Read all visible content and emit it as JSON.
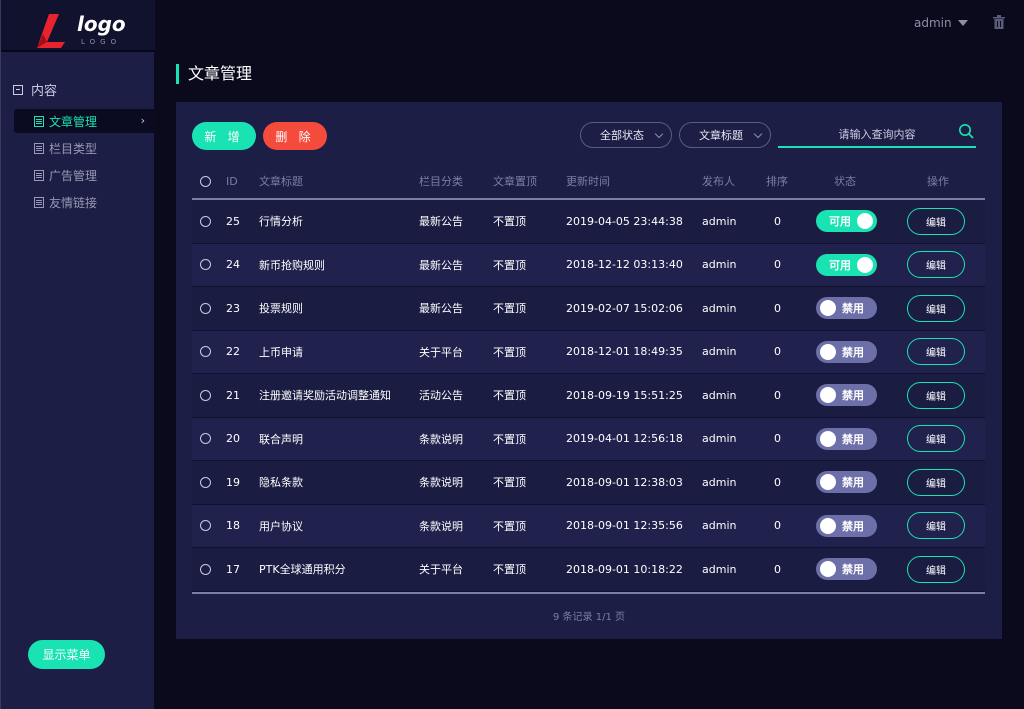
{
  "brand": {
    "logo_text": "logo",
    "logo_sub": "LOGO",
    "colors": {
      "accent": "#19e3b2",
      "danger": "#f44b3d",
      "logo_red": "#e8232d"
    }
  },
  "header": {
    "user": "admin"
  },
  "sidebar": {
    "group_label": "内容",
    "items": [
      {
        "label": "文章管理",
        "active": true
      },
      {
        "label": "栏目类型",
        "active": false
      },
      {
        "label": "广告管理",
        "active": false
      },
      {
        "label": "友情链接",
        "active": false
      }
    ],
    "show_menu_label": "显示菜单"
  },
  "page": {
    "title": "文章管理"
  },
  "toolbar": {
    "add_label": "新 增",
    "delete_label": "删 除",
    "status_select": "全部状态",
    "field_select": "文章标题",
    "search_placeholder": "请输入查询内容"
  },
  "table": {
    "headers": [
      "ID",
      "文章标题",
      "栏目分类",
      "文章置顶",
      "更新时间",
      "发布人",
      "排序",
      "状态",
      "操作"
    ],
    "rows": [
      {
        "id": "25",
        "title": "行情分析",
        "category": "最新公告",
        "pinned": "不置顶",
        "updated": "2019-04-05 23:44:38",
        "author": "admin",
        "sort": "0",
        "status": "可用",
        "enabled": true,
        "action": "编辑"
      },
      {
        "id": "24",
        "title": "新币抢购规则",
        "category": "最新公告",
        "pinned": "不置顶",
        "updated": "2018-12-12 03:13:40",
        "author": "admin",
        "sort": "0",
        "status": "可用",
        "enabled": true,
        "action": "编辑"
      },
      {
        "id": "23",
        "title": "投票规则",
        "category": "最新公告",
        "pinned": "不置顶",
        "updated": "2019-02-07 15:02:06",
        "author": "admin",
        "sort": "0",
        "status": "禁用",
        "enabled": false,
        "action": "编辑"
      },
      {
        "id": "22",
        "title": "上币申请",
        "category": "关于平台",
        "pinned": "不置顶",
        "updated": "2018-12-01 18:49:35",
        "author": "admin",
        "sort": "0",
        "status": "禁用",
        "enabled": false,
        "action": "编辑"
      },
      {
        "id": "21",
        "title": "注册邀请奖励活动调整通知",
        "category": "活动公告",
        "pinned": "不置顶",
        "updated": "2018-09-19 15:51:25",
        "author": "admin",
        "sort": "0",
        "status": "禁用",
        "enabled": false,
        "action": "编辑"
      },
      {
        "id": "20",
        "title": "联合声明",
        "category": "条款说明",
        "pinned": "不置顶",
        "updated": "2019-04-01 12:56:18",
        "author": "admin",
        "sort": "0",
        "status": "禁用",
        "enabled": false,
        "action": "编辑"
      },
      {
        "id": "19",
        "title": "隐私条款",
        "category": "条款说明",
        "pinned": "不置顶",
        "updated": "2018-09-01 12:38:03",
        "author": "admin",
        "sort": "0",
        "status": "禁用",
        "enabled": false,
        "action": "编辑"
      },
      {
        "id": "18",
        "title": "用户协议",
        "category": "条款说明",
        "pinned": "不置顶",
        "updated": "2018-09-01 12:35:56",
        "author": "admin",
        "sort": "0",
        "status": "禁用",
        "enabled": false,
        "action": "编辑"
      },
      {
        "id": "17",
        "title": "PTK全球通用积分",
        "category": "关于平台",
        "pinned": "不置顶",
        "updated": "2018-09-01 10:18:22",
        "author": "admin",
        "sort": "0",
        "status": "禁用",
        "enabled": false,
        "action": "编辑"
      }
    ]
  },
  "pager": {
    "text": "9 条记录 1/1 页"
  }
}
